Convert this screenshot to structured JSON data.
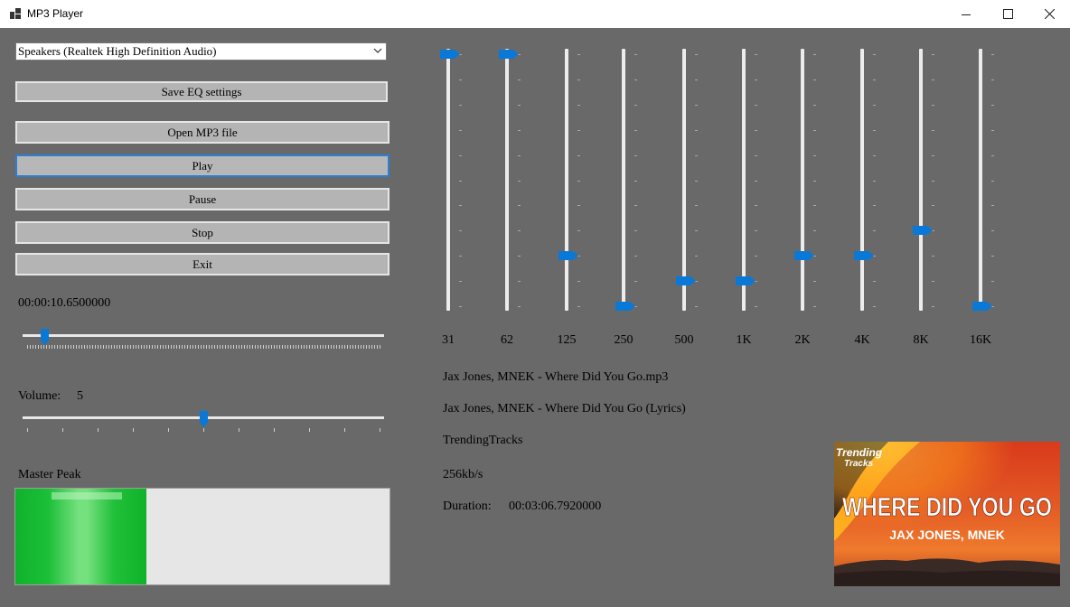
{
  "window": {
    "title": "MP3 Player"
  },
  "device": {
    "selected": "Speakers (Realtek High Definition Audio)"
  },
  "buttons": {
    "save_eq": "Save EQ settings",
    "open": "Open MP3 file",
    "play": "Play",
    "pause": "Pause",
    "stop": "Stop",
    "exit": "Exit"
  },
  "position": {
    "time": "00:00:10.6500000",
    "fraction": 0.06
  },
  "volume": {
    "label": "Volume:",
    "value": "5",
    "min": 0,
    "max": 10
  },
  "peak": {
    "label": "Master Peak",
    "level": 0.35
  },
  "equalizer": {
    "bands": [
      {
        "label": "31",
        "level": 1.0
      },
      {
        "label": "62",
        "level": 1.0
      },
      {
        "label": "125",
        "level": 0.2
      },
      {
        "label": "250",
        "level": 0.0
      },
      {
        "label": "500",
        "level": 0.1
      },
      {
        "label": "1K",
        "level": 0.1
      },
      {
        "label": "2K",
        "level": 0.2
      },
      {
        "label": "4K",
        "level": 0.2
      },
      {
        "label": "8K",
        "level": 0.3
      },
      {
        "label": "16K",
        "level": 0.0
      }
    ]
  },
  "track": {
    "filename": "Jax Jones, MNEK - Where Did You Go.mp3",
    "title": "Jax Jones, MNEK - Where Did You Go (Lyrics)",
    "artist": "TrendingTracks",
    "bitrate": "256kb/s",
    "duration_label": "Duration:",
    "duration": "00:03:06.7920000"
  },
  "album_art": {
    "brand_line1": "Trending",
    "brand_line2": "Tracks",
    "headline": "WHERE DID YOU GO",
    "artist": "JAX JONES, MNEK"
  },
  "colors": {
    "accent": "#0a78d7",
    "background": "#696969",
    "peak": "#12b22e"
  }
}
